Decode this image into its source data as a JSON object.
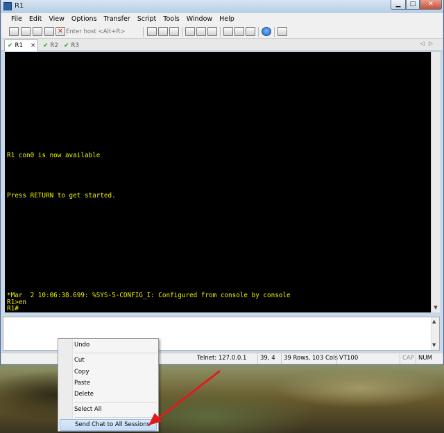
{
  "window": {
    "title": "R1"
  },
  "menubar": [
    "File",
    "Edit",
    "View",
    "Options",
    "Transfer",
    "Script",
    "Tools",
    "Window",
    "Help"
  ],
  "toolbar": {
    "host_placeholder": "Enter host <Alt+R>"
  },
  "tabs": [
    {
      "label": "R1",
      "active": true
    },
    {
      "label": "R2",
      "active": false
    },
    {
      "label": "R3",
      "active": false
    }
  ],
  "terminal": {
    "lines": [
      "R1 con0 is now available",
      "Press RETURN to get started.",
      "*Mar  2 10:06:38.699: %SYS-5-CONFIG_I: Configured from console by console",
      "R1>en",
      "R1#"
    ],
    "text_color": "#f4f000",
    "background": "#000000"
  },
  "chat": {
    "value": ""
  },
  "statusbar": {
    "connection": "Telnet: 127.0.0.1",
    "cursor": "39,  4",
    "dimensions": "39 Rows, 103 Cols",
    "emulation": "VT100",
    "caps": "CAP",
    "num": "NUM"
  },
  "context_menu": {
    "items": [
      "Undo",
      "Cut",
      "Copy",
      "Paste",
      "Delete",
      "Select All",
      "Send Chat to All Sessions"
    ],
    "highlighted": "Send Chat to All Sessions"
  },
  "annotation_arrow_color": "#e11b1b",
  "icons": [
    "app-icon",
    "connect-icon",
    "quick-connect-icon",
    "session-manager-icon",
    "reconnect-icon",
    "disconnect-icon",
    "copy-icon",
    "paste-icon",
    "find-icon",
    "print-setup-icon",
    "print-icon",
    "session-options-icon",
    "global-options-icon",
    "keymap-icon",
    "help-icon",
    "sftp-icon",
    "check-icon"
  ]
}
